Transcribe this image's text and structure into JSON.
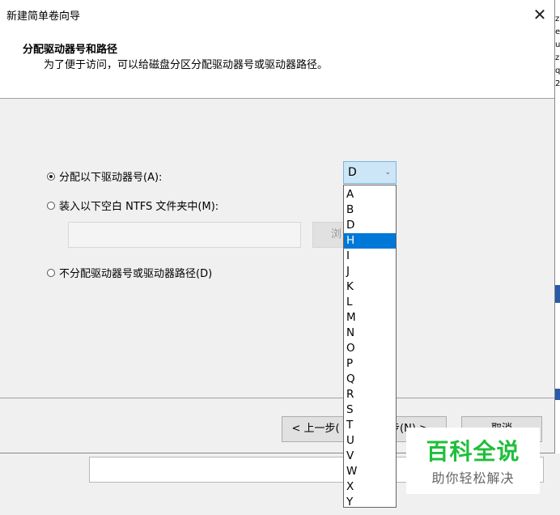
{
  "window": {
    "title": "新建简单卷向导",
    "close_glyph": "✕"
  },
  "header": {
    "title": "分配驱动器号和路径",
    "subtitle": "为了便于访问，可以给磁盘分区分配驱动器号或驱动器路径。"
  },
  "options": {
    "assign_letter": {
      "label": "分配以下驱动器号(A):",
      "checked": true
    },
    "mount_folder": {
      "label": "装入以下空白 NTFS 文件夹中(M):",
      "checked": false
    },
    "no_assign": {
      "label": "不分配驱动器号或驱动器路径(D)",
      "checked": false
    }
  },
  "folder_input": {
    "value": ""
  },
  "browse_button": {
    "label": "浏"
  },
  "drive_select": {
    "value": "D",
    "chevron_icon": "chevron-down-icon",
    "options": [
      "A",
      "B",
      "D",
      "H",
      "I",
      "J",
      "K",
      "L",
      "M",
      "N",
      "O",
      "P",
      "Q",
      "R",
      "S",
      "T",
      "U",
      "V",
      "W",
      "X",
      "Y"
    ],
    "highlighted": "H"
  },
  "footer": {
    "back_label": "< 上一步(",
    "next_label": "步(N) >",
    "cancel_label": "取消"
  },
  "watermark": {
    "main": "百科全说",
    "sub": "助你轻松解决"
  },
  "background_window": {
    "glyphs": [
      "z",
      "e",
      "u",
      "z",
      "q",
      "2"
    ]
  },
  "colors": {
    "selection": "#0078d7",
    "select_bg": "#cde6f7",
    "watermark_green": "#1fbf3a"
  }
}
